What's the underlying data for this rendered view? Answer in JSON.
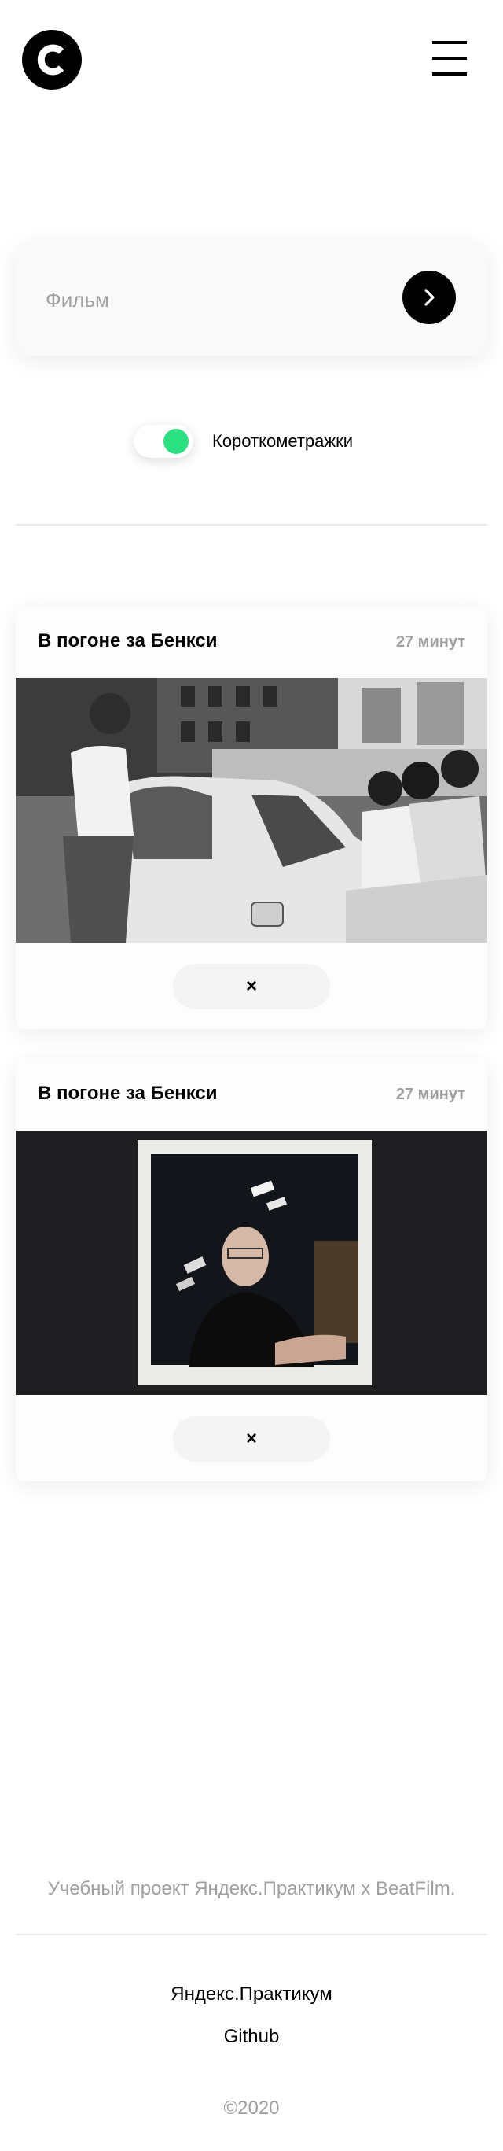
{
  "header": {
    "logo_icon": "logo-c-icon",
    "menu_icon": "hamburger-menu-icon"
  },
  "search": {
    "placeholder": "Фильм",
    "submit_icon": "chevron-right-icon"
  },
  "filter": {
    "short_films_label": "Короткометражки",
    "short_films_enabled": true,
    "accent_color": "#2be080"
  },
  "movies": [
    {
      "title": "В погоне за Бенкси",
      "duration": "27 минут",
      "remove_label": "×"
    },
    {
      "title": "В погоне за Бенкси",
      "duration": "27 минут",
      "remove_label": "×"
    }
  ],
  "footer": {
    "note": "Учебный проект Яндекс.Практикум х BeatFilm.",
    "links": [
      "Яндекс.Практикум",
      "Github"
    ],
    "copyright": "©2020"
  }
}
